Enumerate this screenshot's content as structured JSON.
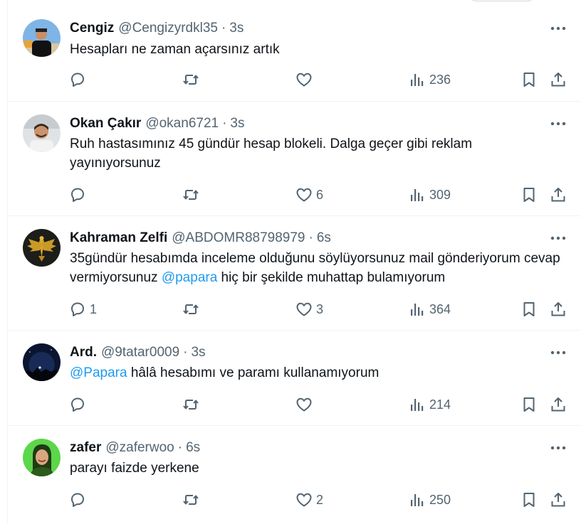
{
  "tweets": [
    {
      "name": "Cengiz",
      "handle": "@Cengizyrdkl35",
      "sep": "·",
      "time": "3s",
      "text": "Hesapları ne zaman açarsınız artık",
      "replies": "",
      "retweets": "",
      "likes": "",
      "views": "236",
      "avatar": "man-black-shirt-avatar"
    },
    {
      "name": "Okan Çakır",
      "handle": "@okan6721",
      "sep": "·",
      "time": "3s",
      "text": "Ruh hastasımınız 45 gündür hesap blokeli. Dalga geçer gibi reklam yayınıyorsunuz",
      "replies": "",
      "retweets": "",
      "likes": "6",
      "views": "309",
      "avatar": "smiling-man-avatar"
    },
    {
      "name": "Kahraman Zelfi",
      "handle": "@ABDOMR88798979",
      "sep": "·",
      "time": "6s",
      "text_pre": "35gündür hesabımda inceleme olduğunu söylüyorsunuz mail gönderiyorum cevap vermiyorsunuz ",
      "mention": "@papara",
      "text_post": " hiç bir şekilde muhattap bulamıyorum",
      "replies": "1",
      "retweets": "",
      "likes": "3",
      "views": "364",
      "avatar": "golden-eagle-emblem-avatar"
    },
    {
      "name": "Ard.",
      "handle": "@9tatar0009",
      "sep": "·",
      "time": "3s",
      "mention": "@Papara",
      "text_post": " hâlâ hesabımı ve paramı kullanamıyorum",
      "replies": "",
      "retweets": "",
      "likes": "",
      "views": "214",
      "avatar": "night-sky-avatar"
    },
    {
      "name": "zafer",
      "handle": "@zaferwoo",
      "sep": "·",
      "time": "6s",
      "text": "parayı faizde yerkene",
      "replies": "",
      "retweets": "",
      "likes": "2",
      "views": "250",
      "avatar": "green-portrait-avatar"
    }
  ],
  "colors": {
    "text": "#0f1419",
    "secondary": "#536471",
    "link": "#1d9bf0",
    "divider": "#eff3f4"
  },
  "icons": [
    "reply-icon",
    "retweet-icon",
    "like-icon",
    "views-icon",
    "bookmark-icon",
    "share-icon",
    "more-icon"
  ]
}
